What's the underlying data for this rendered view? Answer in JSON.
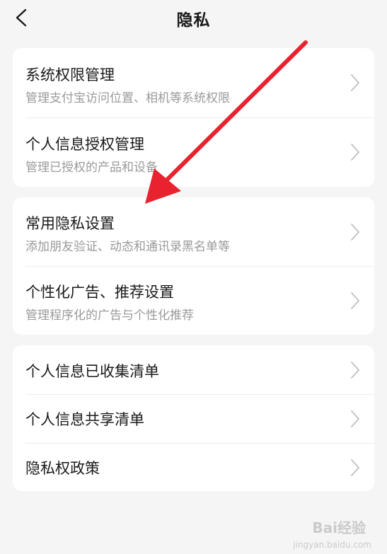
{
  "header": {
    "title": "隐私",
    "back_icon": "chevron-left-icon"
  },
  "groups": [
    {
      "items": [
        {
          "title": "系统权限管理",
          "subtitle": "管理支付宝访问位置、相机等系统权限"
        },
        {
          "title": "个人信息授权管理",
          "subtitle": "管理已授权的产品和设备"
        }
      ]
    },
    {
      "items": [
        {
          "title": "常用隐私设置",
          "subtitle": "添加朋友验证、动态和通讯录黑名单等"
        },
        {
          "title": "个性化广告、推荐设置",
          "subtitle": "管理程序化的广告与个性化推荐"
        }
      ]
    },
    {
      "items": [
        {
          "title": "个人信息已收集清单"
        },
        {
          "title": "个人信息共享清单"
        },
        {
          "title": "隐私权政策"
        }
      ]
    }
  ],
  "watermark": {
    "text": "Bai经验",
    "url": "jingyan.baidu.com"
  },
  "annotation": {
    "color": "#e8232f",
    "icon": "red-arrow-annotation"
  },
  "colors": {
    "background": "#f5f5f5",
    "card": "#ffffff",
    "subtitle": "#9a9a9a"
  }
}
